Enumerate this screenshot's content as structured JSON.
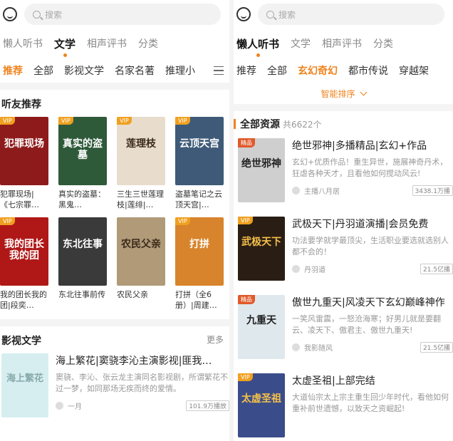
{
  "left": {
    "search_placeholder": "搜索",
    "tabs": [
      "懒人听书",
      "文学",
      "相声评书",
      "分类"
    ],
    "cats": [
      "推荐",
      "全部",
      "影视文学",
      "名家名著",
      "推理小"
    ],
    "friends_title": "听友推荐",
    "books": [
      {
        "title": "犯罪现场|《七宗罪…",
        "cover_text": "犯罪现场",
        "vip": "VIP",
        "color": "#8e1b1b"
      },
      {
        "title": "真实的盗墓：黑鬼…",
        "cover_text": "真实的盗墓",
        "vip": "VIP",
        "color": "#2f5a3a"
      },
      {
        "title": "三生三世莲理枝|莲绯|…",
        "cover_text": "莲理枝",
        "vip": "VIP",
        "color": "#e8dccd"
      },
      {
        "title": "盗墓笔记之云顶天宫|…",
        "cover_text": "云顶天宫",
        "vip": "VIP",
        "color": "#3e5a78"
      },
      {
        "title": "我的团长我的团|段奕…",
        "cover_text": "我的团长我的团",
        "vip": "VIP",
        "color": "#b01818"
      },
      {
        "title": "东北往事前传",
        "cover_text": "东北往事",
        "vip": "",
        "color": "#3a3a3a"
      },
      {
        "title": "农民父亲",
        "cover_text": "农民父亲",
        "vip": "",
        "color": "#b09a78"
      },
      {
        "title": "打拼（全6册）|周建…",
        "cover_text": "打拼",
        "vip": "VIP",
        "color": "#d8842c"
      }
    ],
    "film_title": "影视文学",
    "more": "更多",
    "film_item": {
      "title": "海上繁花|窦骁李沁主演影视|匪我…",
      "desc": "窦骁、李沁、张云龙主演同名影视剧，所谓繁花不过一梦，如同那场无疾而终的爱情。",
      "author": "一月",
      "plays": "101.9万播放"
    }
  },
  "right": {
    "search_placeholder": "搜索",
    "tabs": [
      "懒人听书",
      "文学",
      "相声评书",
      "分类"
    ],
    "cats": [
      "推荐",
      "全部",
      "玄幻奇幻",
      "都市传说",
      "穿越架"
    ],
    "sort_label": "智能排序",
    "res_title": "全部资源",
    "res_count": "共6622个",
    "items": [
      {
        "badge": "精品",
        "badge_color": "#e05a2a",
        "cover_text": "绝世邪神",
        "cover_color": "#cfcfcf",
        "title": "绝世邪神|多播精品|玄幻+作品",
        "desc": "玄幻+优质作品！重生异世，施展神奇丹术，狂虐各种天才，且看他如何搅动风云!",
        "author": "主播八月居",
        "plays": "3438.1万播"
      },
      {
        "badge": "VIP",
        "badge_color": "#f0a020",
        "cover_text": "武极天下",
        "cover_color": "#2a1e14",
        "title": "武极天下|丹羽道演播|会员免费",
        "desc": "功法要学就学最顶尖，生活职业要选就选别人都不会的！",
        "author": "丹羽道",
        "plays": "21.5亿播"
      },
      {
        "badge": "精品",
        "badge_color": "#e05a2a",
        "cover_text": "九重天",
        "cover_color": "#dfe8ec",
        "title": "傲世九重天|风凌天下玄幻巅峰神作",
        "desc": "一笑风雷震，一怒沧海寒；好男儿就是要翻云、凌天下、傲君主、傲世九重天!",
        "author": "我影随风",
        "plays": "21.5亿播"
      },
      {
        "badge": "VIP",
        "badge_color": "#f0a020",
        "cover_text": "太虚圣祖",
        "cover_color": "#3a4d8a",
        "title": "太虚圣祖|上部完结",
        "desc": "大道仙宗太上宗主重生回少年时代，看他如何重补前世遗憾，以致天之资崛起!",
        "author": "",
        "plays": ""
      }
    ]
  }
}
